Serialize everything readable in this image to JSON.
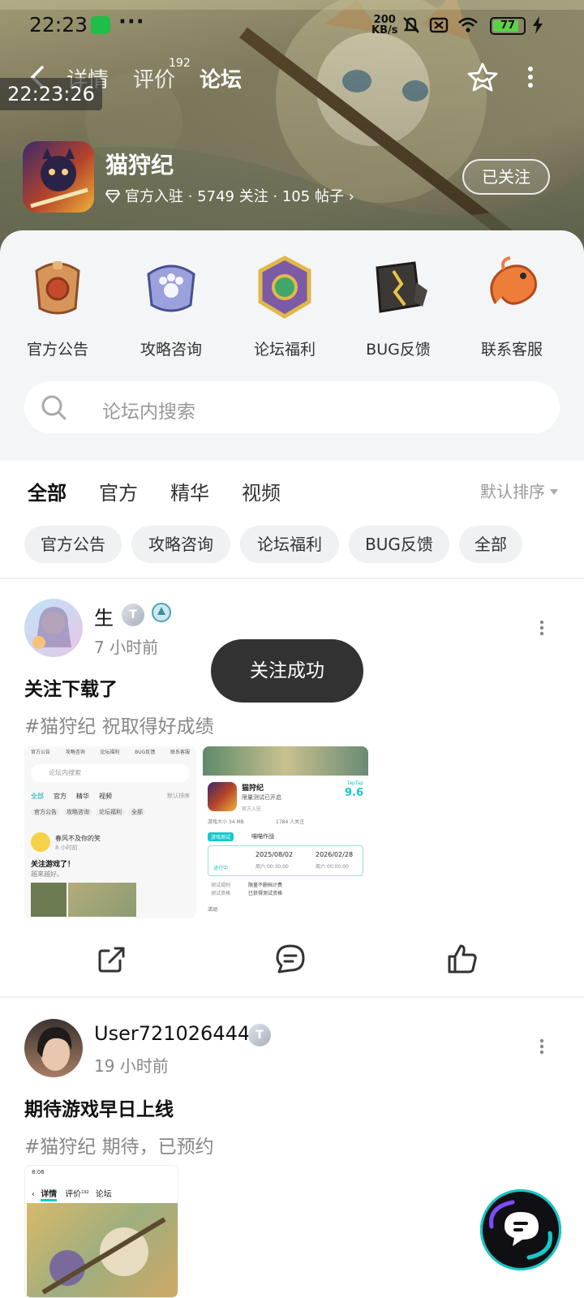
{
  "status_bar": {
    "time": "22:23",
    "more": "···",
    "net_speed_value": "200",
    "net_speed_unit": "KB/s",
    "battery": "77"
  },
  "overlay_clock": "22:23:26",
  "nav": {
    "tabs": [
      {
        "label": "详情"
      },
      {
        "label": "评价",
        "badge": "192"
      },
      {
        "label": "论坛"
      }
    ]
  },
  "game": {
    "name": "猫狩纪",
    "meta": "官方入驻 · 5749 关注 · 105 帖子",
    "follow_label": "已关注"
  },
  "categories": [
    {
      "label": "官方公告",
      "icon": "announcement-icon"
    },
    {
      "label": "攻略咨询",
      "icon": "guide-icon"
    },
    {
      "label": "论坛福利",
      "icon": "welfare-icon"
    },
    {
      "label": "BUG反馈",
      "icon": "bug-icon"
    },
    {
      "label": "联系客服",
      "icon": "service-icon"
    }
  ],
  "search": {
    "placeholder": "论坛内搜索"
  },
  "filter_tabs": [
    "全部",
    "官方",
    "精华",
    "视频"
  ],
  "sort_label": "默认排序",
  "chips": [
    "官方公告",
    "攻略咨询",
    "论坛福利",
    "BUG反馈",
    "全部"
  ],
  "toast": "关注成功",
  "posts": [
    {
      "author": "生",
      "time": "7 小时前",
      "title": "关注下载了",
      "tags": "#猫狩纪 祝取得好成绩",
      "thumb_left": {
        "cats": [
          "官方公告",
          "攻略咨询",
          "论坛福利",
          "BUG反馈",
          "联系客服"
        ],
        "search": "论坛内搜索",
        "tabs": [
          "全部",
          "官方",
          "精华",
          "视频"
        ],
        "sort": "默认排序",
        "chips": [
          "官方公告",
          "攻略咨询",
          "论坛福利",
          "全部"
        ],
        "author": "春风不及你的笑",
        "time": "8 小时前",
        "title": "关注游戏了！",
        "body": "越来越好。"
      },
      "thumb_right": {
        "name": "猫狩纪",
        "subtitle": "限量测试已开启",
        "tag": "官方入驻",
        "rating_brand": "TapTap",
        "rating": "9.6",
        "size": "游戏大小 34 MB",
        "followers": "1784 人关注",
        "badge": "游戏测试",
        "test_name": "喵喵作战",
        "status": "进行中",
        "start_date": "2025/08/02",
        "start_time": "周六 00:30:00",
        "end_date": "2026/02/28",
        "end_time": "周六 00:00:00",
        "rule_label": "测试规则",
        "rule": "限量不删档计费",
        "qual_label": "测试资格",
        "qual": "已获得测试资格",
        "activity": "活动"
      }
    },
    {
      "author": "User721026444",
      "time": "19 小时前",
      "title": "期待游戏早日上线",
      "tags": "#猫狩纪 期待，已预约",
      "thumb": {
        "status": "8:06",
        "tabs": [
          "详情",
          "评价",
          "论坛"
        ],
        "badge": "192"
      }
    }
  ],
  "colors": {
    "accent": "#14c9c9",
    "toast_bg": "#323232"
  }
}
